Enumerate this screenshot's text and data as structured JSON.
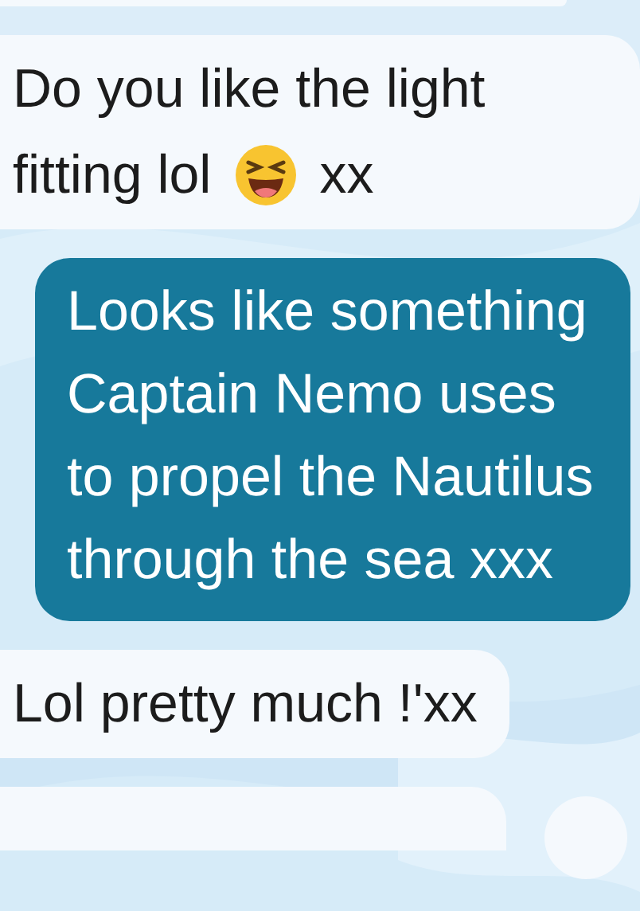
{
  "messages": [
    {
      "kind": "incoming_cut"
    },
    {
      "kind": "incoming",
      "parts": [
        {
          "kind": "line",
          "text": "Do you like the light"
        },
        {
          "kind": "text",
          "text": "fitting lol"
        },
        {
          "kind": "emoji"
        },
        {
          "kind": "text",
          "text": "xx"
        }
      ]
    },
    {
      "kind": "outgoing",
      "text": "Looks like something Captain Nemo uses to propel the Nautilus through the sea xxx"
    },
    {
      "kind": "incoming",
      "parts": [
        {
          "kind": "line",
          "text": "Lol pretty much !'xx"
        }
      ]
    },
    {
      "kind": "incoming_bottom_cut"
    }
  ]
}
